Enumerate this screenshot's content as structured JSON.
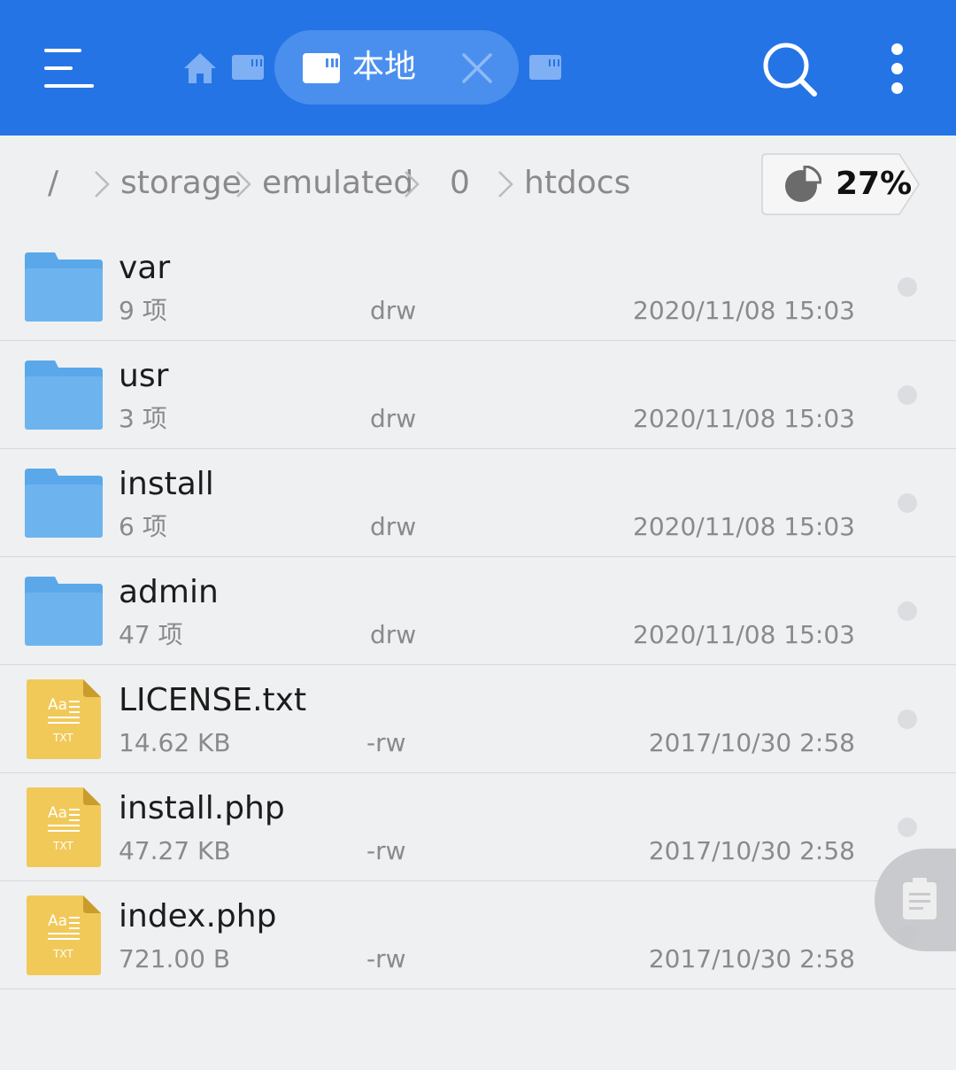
{
  "header": {
    "tab_label": "本地",
    "accent": "#2574e5",
    "icons": [
      "menu-icon",
      "home-icon",
      "sd-card-icon",
      "close-icon",
      "search-icon",
      "more-vert-icon"
    ]
  },
  "breadcrumb": {
    "items": [
      "/",
      "storage",
      "emulated",
      "0",
      "htdocs"
    ],
    "storage_used": "27%"
  },
  "files": [
    {
      "name": "var",
      "sub": "9 项",
      "perm": "drw",
      "date": "2020/11/08 15:03",
      "kind": "folder"
    },
    {
      "name": "usr",
      "sub": "3 项",
      "perm": "drw",
      "date": "2020/11/08 15:03",
      "kind": "folder"
    },
    {
      "name": "install",
      "sub": "6 项",
      "perm": "drw",
      "date": "2020/11/08 15:03",
      "kind": "folder"
    },
    {
      "name": "admin",
      "sub": "47 项",
      "perm": "drw",
      "date": "2020/11/08 15:03",
      "kind": "folder"
    },
    {
      "name": "LICENSE.txt",
      "sub": "14.62 KB",
      "perm": "-rw",
      "date": "2017/10/30 2:58",
      "kind": "text"
    },
    {
      "name": "install.php",
      "sub": "47.27 KB",
      "perm": "-rw",
      "date": "2017/10/30 2:58",
      "kind": "text"
    },
    {
      "name": "index.php",
      "sub": "721.00 B",
      "perm": "-rw",
      "date": "2017/10/30 2:58",
      "kind": "text"
    }
  ],
  "file_icon_label": {
    "top": "Aa",
    "bottom": "TXT"
  }
}
